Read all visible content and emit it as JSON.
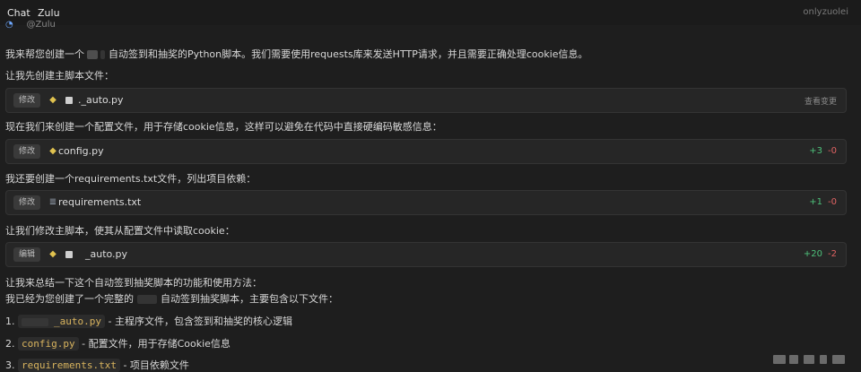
{
  "topbar": {
    "tabs": [
      "Chat",
      "Zulu"
    ],
    "user": "onlyzuolei"
  },
  "message": {
    "handle": "@Zulu",
    "intro_before": "我来帮您创建一个",
    "intro_after": "自动签到和抽奖的Python脚本。我们需要使用requests库来发送HTTP请求，并且需要正确处理cookie信息。",
    "step1": "让我先创建主脚本文件：",
    "step2": "现在我们来创建一个配置文件，用于存储cookie信息，这样可以避免在代码中直接硬编码敏感信息：",
    "step3": "我还要创建一个requirements.txt文件，列出项目依赖：",
    "step4": "让我们修改主脚本，使其从配置文件中读取cookie：",
    "summary_title": "让我来总结一下这个自动签到抽奖脚本的功能和使用方法：",
    "summary_before": "我已经为您创建了一个完整的",
    "summary_after": "自动签到抽奖脚本，主要包含以下文件："
  },
  "cards": [
    {
      "tag": "修改",
      "file": "._auto.py",
      "right": "查看变更"
    },
    {
      "tag": "修改",
      "file": "config.py",
      "add": "+3",
      "del": "-0"
    },
    {
      "tag": "修改",
      "file": "requirements.txt",
      "add": "+1",
      "del": "-0"
    },
    {
      "tag": "编辑",
      "file": "_auto.py",
      "add": "+20",
      "del": "-2"
    }
  ],
  "list": [
    {
      "num": "1.",
      "code": "_auto.py",
      "desc": "- 主程序文件，包含签到和抽奖的核心逻辑"
    },
    {
      "num": "2.",
      "code": "config.py",
      "desc": "- 配置文件，用于存储Cookie信息"
    },
    {
      "num": "3.",
      "code": "requirements.txt",
      "desc": "- 项目依赖文件"
    }
  ]
}
